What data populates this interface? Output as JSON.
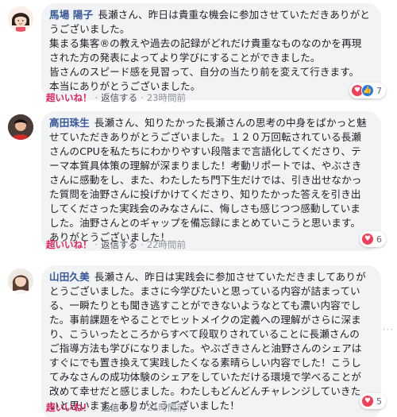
{
  "comments": [
    {
      "name": "馬場 陽子",
      "lines": [
        "長瀬さん、昨日は貴重な機会に参加させていただきありがと",
        "うございました。",
        "集まる集客®の教えや過去の記録がどれだけ貴重なものなのかを再現",
        "された方の発表によってより学びにすることができました。",
        "皆さんのスピード感を見習って、自分の当たり前を変えて行きます。",
        "本当にありがとうございました。"
      ],
      "reaction_count": "7",
      "like_label": "超いいね！",
      "reply_label": "返信する",
      "time": "23時間前"
    },
    {
      "name": "高田珠生",
      "lines": [
        "長瀬さん、知りたかった長瀬さんの思考の中身をぱかっと魅",
        "せていただきありがとうございました。１２０万回転されている長瀬",
        "さんのCPUを私たちにわかりやすい段階まで言語化してくださり、テ",
        "ーマ本質具体策の理解が深まりました！考動リポートでは、やぶさき",
        "さんに感動をし、また、わたしたち門下生だけでは、引き出せなかっ",
        "た質問を油野さんに投げかけてくださり、知りたかった答えを引き出",
        "してくださった実践会のみなさんに、悔しさも感じつつ感動していま",
        "した。油野さんとのギャップを備忘録にまとめていこうと思います。",
        "ありがとうございました！"
      ],
      "reaction_count": "6",
      "like_label": "超いいね！",
      "reply_label": "返信する",
      "time": "22時間前"
    },
    {
      "name": "山田久美",
      "lines": [
        "長瀬さん、昨日は実践会に参加させていただきましてありが",
        "とうございました。まさに今学びたいと思っている内容が詰まってい",
        "る、一瞬たりとも聞き逃すことができないようなとても濃い内容でし",
        "た。事前課題をやることでヒットメイクの定義への理解がさらに深ま",
        "り、こういったところからすべて段取りされていることに長瀬さんの",
        "ご指導方法も学びになりました。やぶざきさんと油野さんのシェアは",
        "すぐにでも置き換えて実践したくなる素晴らしい内容でした！こうし",
        "てみなさんの成功体験のシェアをしていただける環境で学べることが",
        "改めて幸せだと感じました。わたしもどんどんチャレンジしていきた",
        "いと思います。ありがとうございました！"
      ],
      "reaction_count": "5",
      "like_label": "超いいね！",
      "reply_label": "返信する",
      "time": "21時間前"
    }
  ],
  "separator": "·",
  "icons": {
    "love": "heart-icon",
    "like": "thumbs-up-icon",
    "more": "more-dots-icon"
  },
  "colors": {
    "name": "#385898",
    "love": "#f33e58",
    "like": "#2078f4",
    "bubble": "#f2f3f5"
  }
}
